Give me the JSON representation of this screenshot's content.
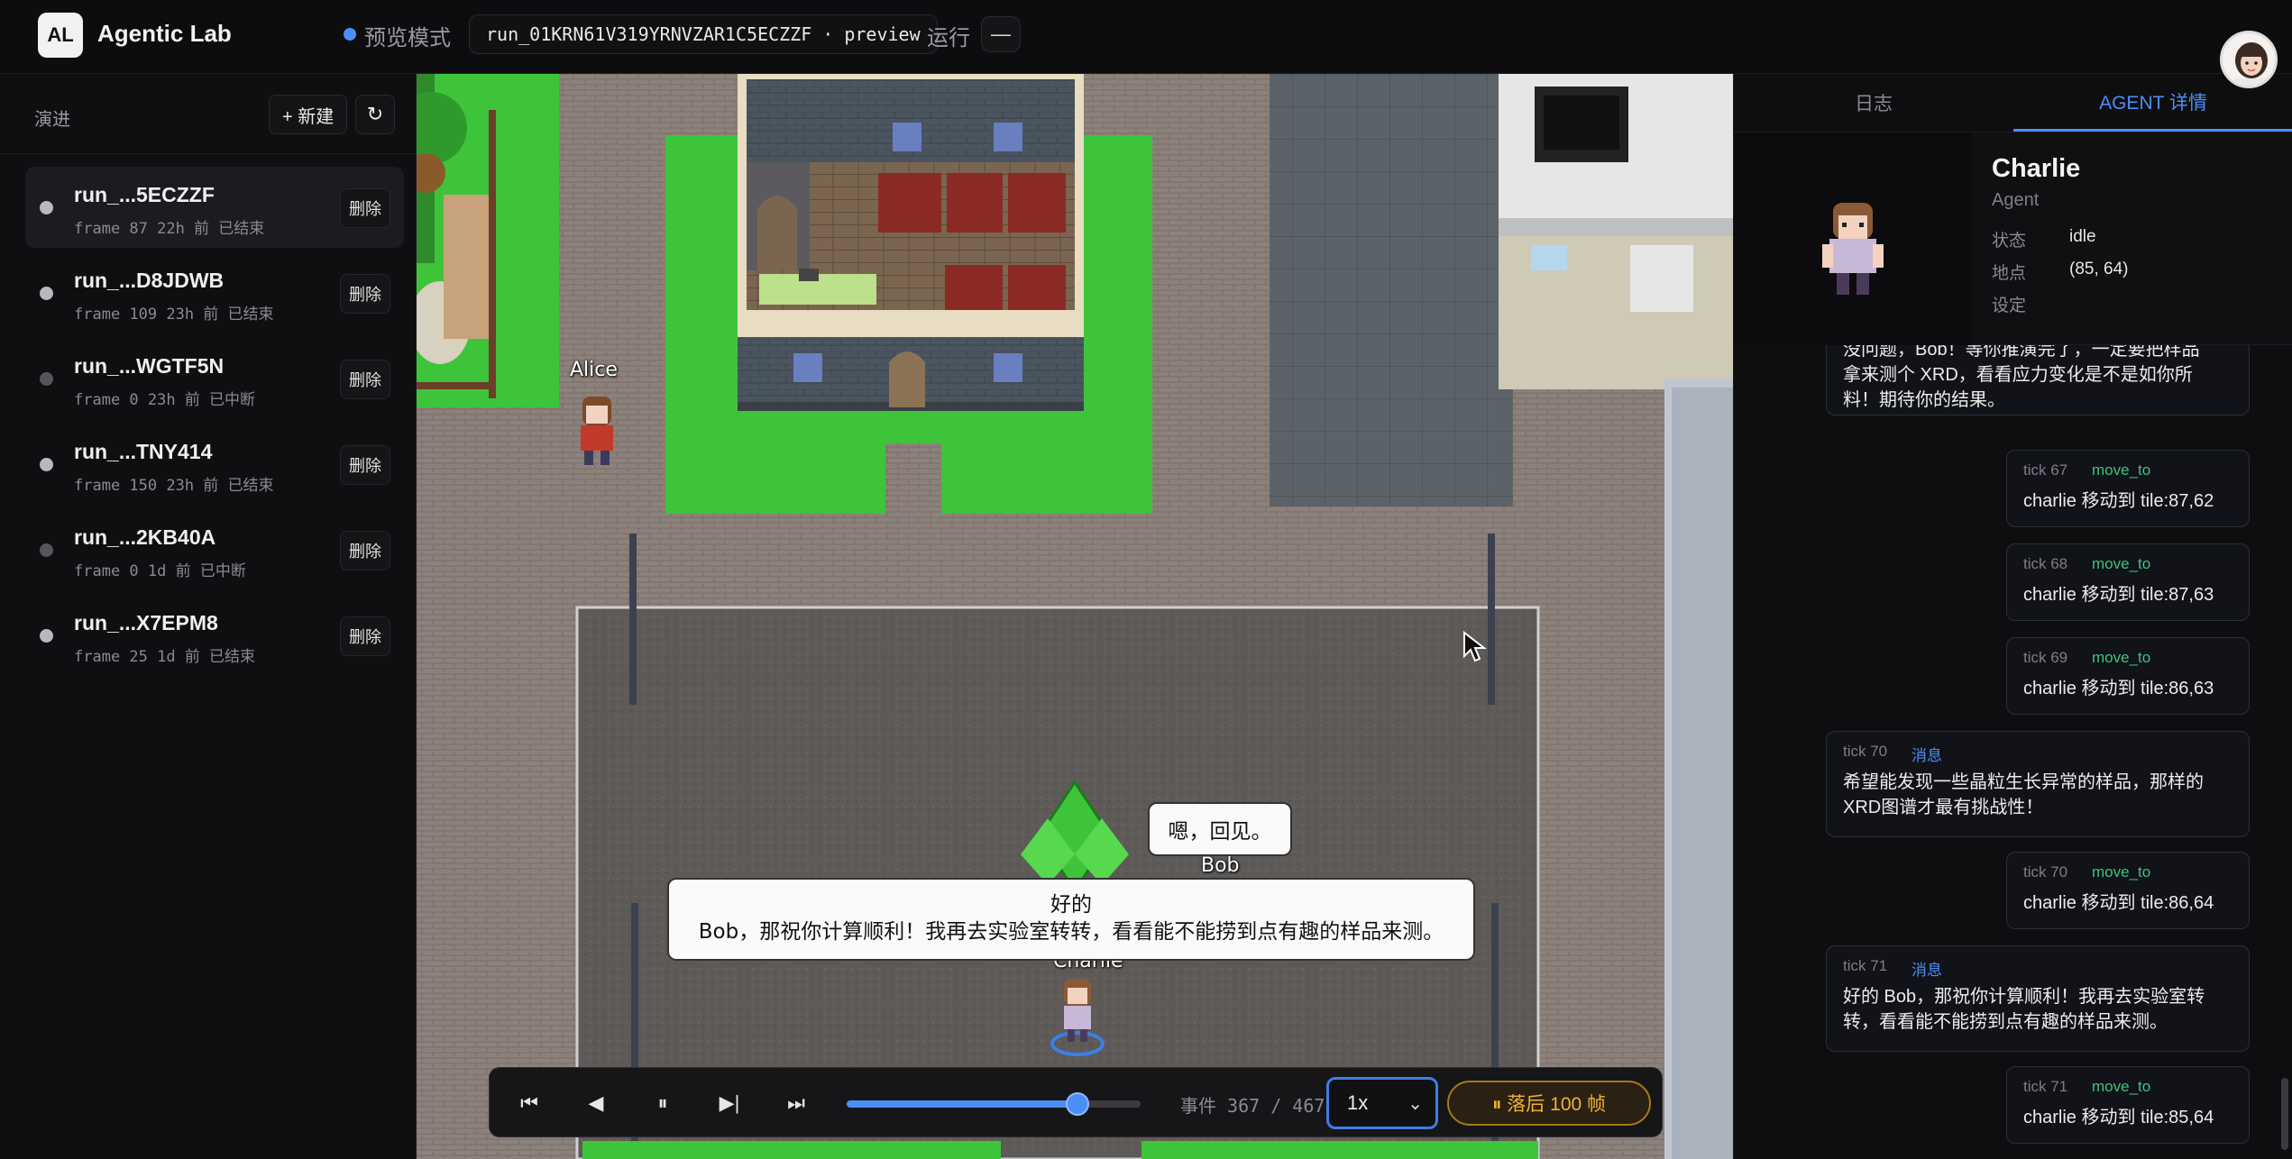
{
  "header": {
    "logo": "AL",
    "app_title": "Agentic Lab",
    "mode_label": "预览模式",
    "run_id": "run_01KRN61V319YRNVZAR1C5ECZZF · preview",
    "run_status_label": "运行",
    "run_status_value": "—"
  },
  "sidebar": {
    "section_label": "演进",
    "new_button": "+ 新建",
    "refresh_icon": "↻",
    "delete_label": "删除",
    "runs": [
      {
        "name": "run_...5ECZZF",
        "meta": "frame 87 22h 前 已结束",
        "active": true
      },
      {
        "name": "run_...D8JDWB",
        "meta": "frame 109 23h 前 已结束"
      },
      {
        "name": "run_...WGTF5N",
        "meta": "frame 0 23h 前 已中断"
      },
      {
        "name": "run_...TNY414",
        "meta": "frame 150 23h 前 已结束"
      },
      {
        "name": "run_...2KB40A",
        "meta": "frame 0 1d 前 已中断"
      },
      {
        "name": "run_...X7EPM8",
        "meta": "frame 25 1d 前 已结束"
      }
    ]
  },
  "map": {
    "names": {
      "alice": "Alice",
      "bob": "Bob",
      "charlie": "Charlie"
    },
    "bubble_bob": "嗯，回见。",
    "bubble_charlie_line1": "好的",
    "bubble_charlie_line2": "Bob，那祝你计算顺利！我再去实验室转转，看看能不能捞到点有趣的样品来测。"
  },
  "player": {
    "icons": {
      "first": "⏮",
      "prev": "◀",
      "pause": "⏸",
      "step": "▶|",
      "last": "⏭"
    },
    "event_label": "事件 367 / 467",
    "event_current": 367,
    "event_total": 467,
    "speed": "1x",
    "lag_label": "⏸ 落后 100 帧"
  },
  "right_panel": {
    "tabs": [
      "日志",
      "AGENT 详情"
    ],
    "agent": {
      "name": "Charlie",
      "role": "Agent",
      "status_label": "状态",
      "status_value": "idle",
      "location_label": "地点",
      "location_value": "(85, 64)",
      "setting_label": "设定"
    },
    "feed": {
      "msg_top": [
        "没问题，Bob！等你推演完了，一定要把样品",
        "拿来测个 XRD，看看应力变化是不是如你所",
        "料！期待你的结果。"
      ],
      "move_67": {
        "tick": "tick 67",
        "type": "move_to",
        "text": "charlie 移动到 tile:87,62"
      },
      "move_68": {
        "tick": "tick 68",
        "type": "move_to",
        "text": "charlie 移动到 tile:87,63"
      },
      "move_69": {
        "tick": "tick 69",
        "type": "move_to",
        "text": "charlie 移动到 tile:86,63"
      },
      "msg_70": {
        "tick": "tick 70",
        "type": "消息",
        "line1": "希望能发现一些晶粒生长异常的样品，那样的",
        "line2": "XRD图谱才最有挑战性！"
      },
      "move_70": {
        "tick": "tick 70",
        "type": "move_to",
        "text": "charlie 移动到 tile:86,64"
      },
      "msg_71": {
        "tick": "tick 71",
        "type": "消息",
        "line1": "好的 Bob，那祝你计算顺利！我再去实验室转",
        "line2": "转，看看能不能捞到点有趣的样品来测。"
      },
      "move_71": {
        "tick": "tick 71",
        "type": "move_to",
        "text": "charlie 移动到 tile:85,64"
      }
    }
  },
  "colors": {
    "accent": "#4b8ef7",
    "move": "#3fc27f",
    "warning": "#f0b232",
    "grass": "#3ec43a"
  }
}
